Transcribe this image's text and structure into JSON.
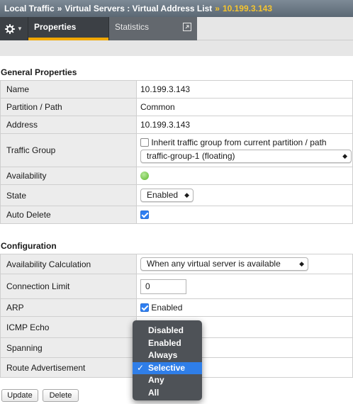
{
  "breadcrumb": {
    "part1": "Local Traffic",
    "sep1": "»",
    "part2": "Virtual Servers : Virtual Address List",
    "sep2": "»",
    "current": "10.199.3.143"
  },
  "tabs": {
    "properties": "Properties",
    "statistics": "Statistics"
  },
  "general": {
    "title": "General Properties",
    "rows": {
      "name_label": "Name",
      "name_value": "10.199.3.143",
      "partition_label": "Partition / Path",
      "partition_value": "Common",
      "address_label": "Address",
      "address_value": "10.199.3.143",
      "traffic_label": "Traffic Group",
      "traffic_inherit": "Inherit traffic group from current partition / path",
      "traffic_select": "traffic-group-1 (floating)",
      "availability_label": "Availability",
      "state_label": "State",
      "state_value": "Enabled",
      "autodelete_label": "Auto Delete"
    }
  },
  "configuration": {
    "title": "Configuration",
    "rows": {
      "avail_calc_label": "Availability Calculation",
      "avail_calc_value": "When any virtual server is available",
      "conn_limit_label": "Connection Limit",
      "conn_limit_value": "0",
      "arp_label": "ARP",
      "arp_value": "Enabled",
      "icmp_label": "ICMP Echo",
      "spanning_label": "Spanning",
      "route_label": "Route Advertisement"
    }
  },
  "dropdown": {
    "options": [
      "Disabled",
      "Enabled",
      "Always",
      "Selective",
      "Any",
      "All"
    ],
    "selected": "Selective",
    "checkmark": "✓"
  },
  "buttons": {
    "update": "Update",
    "delete": "Delete"
  },
  "colors": {
    "accent": "#f1a800",
    "highlight": "#f4c430",
    "menu_selected": "#2f7ee8",
    "status_green": "#5cb82c"
  }
}
